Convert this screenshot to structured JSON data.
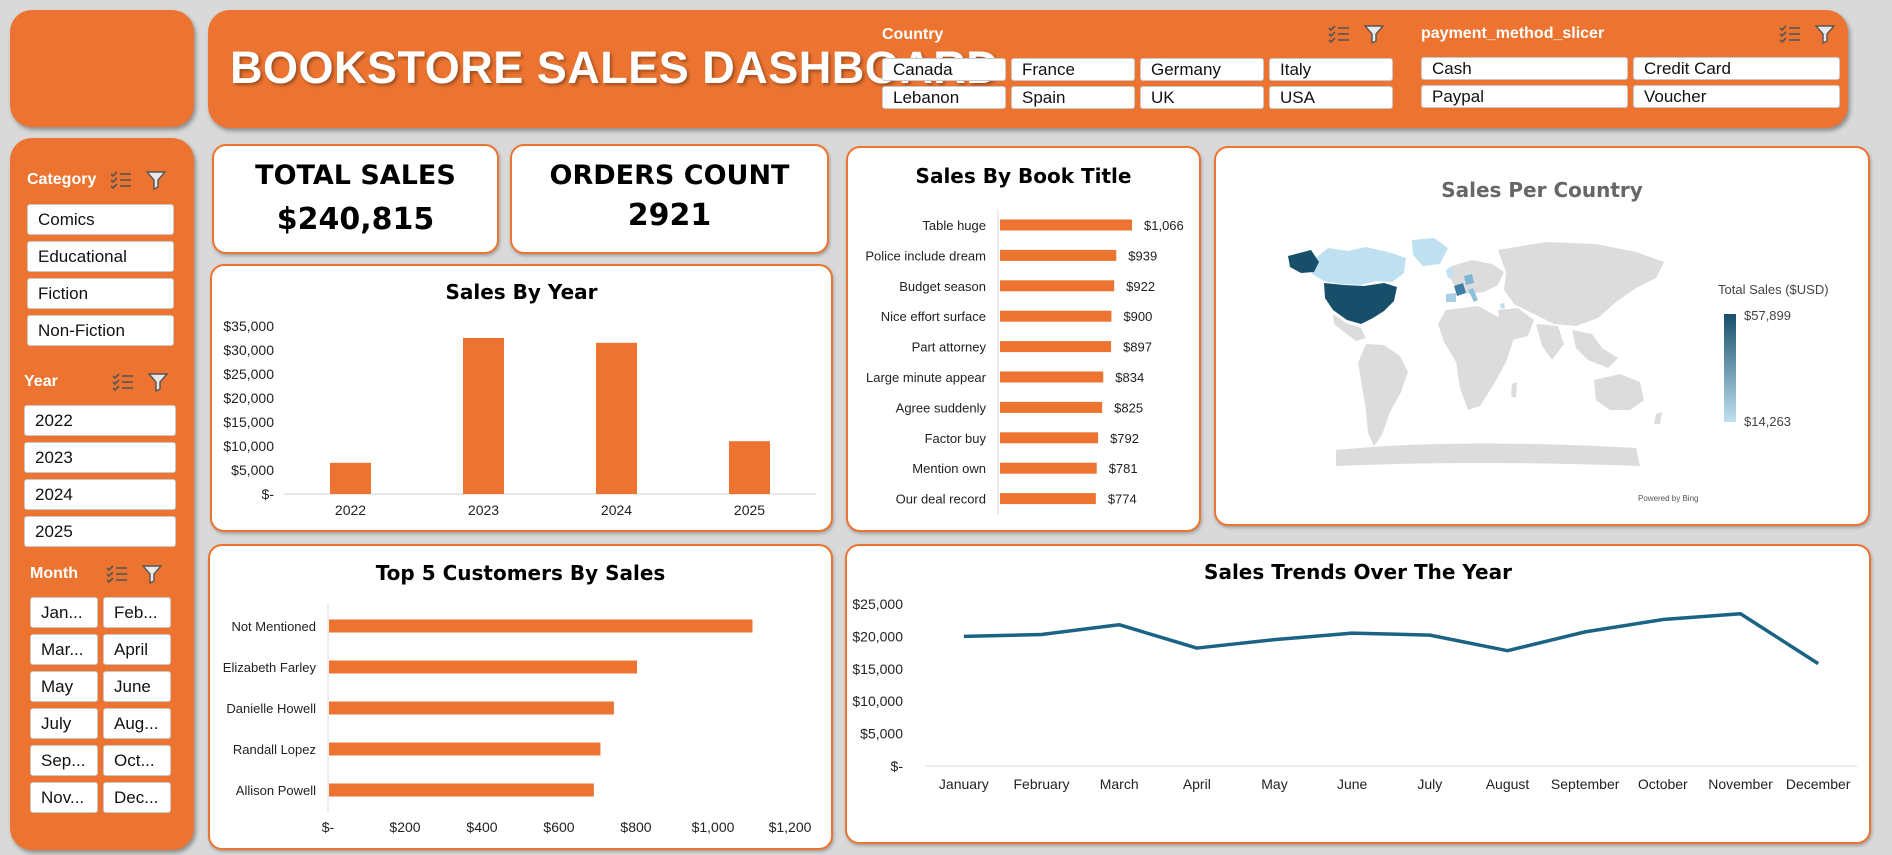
{
  "header": {
    "title": "BOOKSTORE SALES DASHBOARD"
  },
  "slicers": {
    "country": {
      "label": "Country",
      "items": [
        "Canada",
        "France",
        "Germany",
        "Italy",
        "Lebanon",
        "Spain",
        "UK",
        "USA"
      ]
    },
    "payment": {
      "label": "payment_method_slicer",
      "items": [
        "Cash",
        "Credit Card",
        "Paypal",
        "Voucher"
      ]
    },
    "category": {
      "label": "Category",
      "items": [
        "Comics",
        "Educational",
        "Fiction",
        "Non-Fiction"
      ]
    },
    "year": {
      "label": "Year",
      "items": [
        "2022",
        "2023",
        "2024",
        "2025"
      ]
    },
    "month": {
      "label": "Month",
      "items": [
        "Jan...",
        "Feb...",
        "Mar...",
        "April",
        "May",
        "June",
        "July",
        "Aug...",
        "Sep...",
        "Oct...",
        "Nov...",
        "Dec..."
      ]
    }
  },
  "kpis": {
    "total_sales": {
      "label": "TOTAL SALES",
      "value": "$240,815"
    },
    "orders_count": {
      "label": "ORDERS COUNT",
      "value": "2921"
    }
  },
  "colors": {
    "accent": "#ec7430",
    "line": "#1b6384",
    "map_dark": "#174f6b",
    "map_light": "#bfe0f0",
    "map_land": "#dcdcdc"
  },
  "map": {
    "title": "Sales Per Country",
    "legend_title": "Total Sales ($USD)",
    "legend_max": "$57,899",
    "legend_min": "$14,263",
    "attribution": "Powered by Bing"
  },
  "chart_data": [
    {
      "id": "sales_by_year",
      "type": "bar",
      "title": "Sales By Year",
      "categories": [
        "2022",
        "2023",
        "2024",
        "2025"
      ],
      "values": [
        6500,
        32500,
        31500,
        11000
      ],
      "ylim": [
        0,
        35000
      ],
      "yticks": [
        "$-",
        "$5,000",
        "$10,000",
        "$15,000",
        "$20,000",
        "$25,000",
        "$30,000",
        "$35,000"
      ],
      "grid": false
    },
    {
      "id": "sales_by_title",
      "type": "bar",
      "orientation": "horizontal",
      "title": "Sales By Book Title",
      "categories": [
        "Table huge",
        "Police include dream",
        "Budget season",
        "Nice effort surface",
        "Part attorney",
        "Large minute appear",
        "Agree suddenly",
        "Factor buy",
        "Mention own",
        "Our deal record"
      ],
      "values": [
        1066,
        939,
        922,
        900,
        897,
        834,
        825,
        792,
        781,
        774
      ],
      "labels": [
        "$1,066",
        "$939",
        "$922",
        "$900",
        "$897",
        "$834",
        "$825",
        "$792",
        "$781",
        "$774"
      ]
    },
    {
      "id": "top_customers",
      "type": "bar",
      "orientation": "horizontal",
      "title": "Top 5 Customers By Sales",
      "categories": [
        "Not Mentioned",
        "Elizabeth Farley",
        "Danielle Howell",
        "Randall Lopez",
        "Allison Powell"
      ],
      "values": [
        1100,
        800,
        740,
        705,
        688
      ],
      "xlim": [
        0,
        1200
      ],
      "xticks": [
        "$-",
        "$200",
        "$400",
        "$600",
        "$800",
        "$1,000",
        "$1,200"
      ]
    },
    {
      "id": "sales_trend",
      "type": "line",
      "title": "Sales Trends Over The Year",
      "categories": [
        "January",
        "February",
        "March",
        "April",
        "May",
        "June",
        "July",
        "August",
        "September",
        "October",
        "November",
        "December"
      ],
      "values": [
        20000,
        20300,
        21800,
        18200,
        19500,
        20500,
        20200,
        17800,
        20700,
        22600,
        23500,
        15800
      ],
      "ylim": [
        0,
        25000
      ],
      "yticks": [
        "$-",
        "$5,000",
        "$10,000",
        "$15,000",
        "$20,000",
        "$25,000"
      ]
    }
  ]
}
